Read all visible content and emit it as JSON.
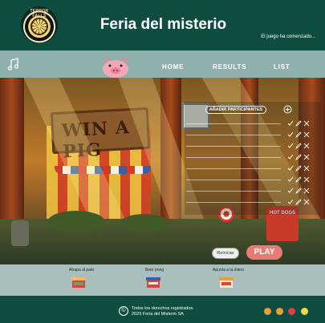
{
  "header": {
    "logo_text": "TERROR FALLS",
    "title": "Feria del misterio",
    "status": "El juego ha comenzado..."
  },
  "nav": {
    "items": [
      {
        "label": "HOME"
      },
      {
        "label": "RESULTS"
      },
      {
        "label": "LIST"
      }
    ]
  },
  "scene": {
    "sign_text": "WIN A PIG",
    "hotdog_text": "HOT DOGS",
    "add_participants_label": "AÑADIR PARTICIPANTES",
    "participant_rows": 8,
    "reset_label": "Reiniciar",
    "play_label": "PLAY"
  },
  "games": [
    {
      "label": "Atrapa al pato"
    },
    {
      "label": "Beer pong"
    },
    {
      "label": "Apunta a la diana"
    }
  ],
  "footer": {
    "line1": "Todos los derechos registrados.",
    "line2": "2023 Feria del Misterio SA",
    "social": [
      {
        "icon": "facebook-icon",
        "color": "#e8a13a"
      },
      {
        "icon": "instagram-icon",
        "color": "#e8a13a"
      },
      {
        "icon": "pinterest-icon",
        "color": "#d8453c"
      },
      {
        "icon": "youtube-icon",
        "color": "#f2d64a"
      }
    ]
  },
  "colors": {
    "header_bg": "#0e4d3f",
    "nav_bg": "#8fb0ad",
    "play_button": "#e87a78",
    "games_bg": "#a9bebd"
  }
}
